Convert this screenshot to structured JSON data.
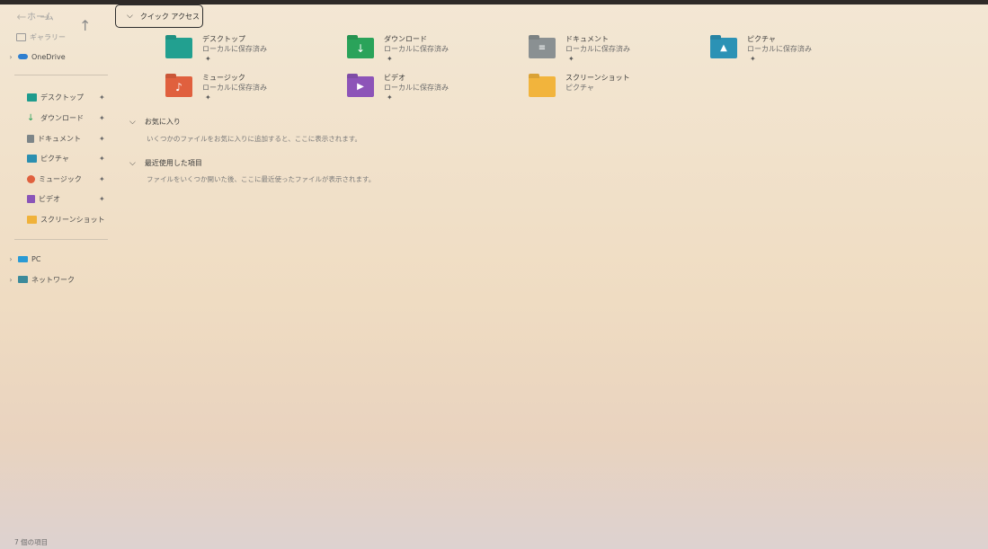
{
  "nav": {
    "home_label": "ホーム"
  },
  "sidebar": {
    "top_items": [
      {
        "label": "ギャラリー",
        "icon": "gallery-icon"
      },
      {
        "label": "OneDrive",
        "icon": "cloud-icon"
      }
    ],
    "pinned": [
      {
        "label": "デスクトップ",
        "icon": "desktop-folder-icon",
        "color": "#1e9c8e"
      },
      {
        "label": "ダウンロード",
        "icon": "download-icon",
        "color": "#2aa35a"
      },
      {
        "label": "ドキュメント",
        "icon": "document-icon",
        "color": "#7d8588"
      },
      {
        "label": "ピクチャ",
        "icon": "pictures-icon",
        "color": "#2b8fb0"
      },
      {
        "label": "ミュージック",
        "icon": "music-icon",
        "color": "#e0603e"
      },
      {
        "label": "ビデオ",
        "icon": "video-icon",
        "color": "#8a55b8"
      },
      {
        "label": "スクリーンショット",
        "icon": "folder-icon",
        "color": "#f0b23a"
      }
    ],
    "bottom_items": [
      {
        "label": "PC",
        "icon": "pc-icon"
      },
      {
        "label": "ネットワーク",
        "icon": "network-icon"
      }
    ]
  },
  "main": {
    "quick_access_title": "クイック アクセス",
    "tiles": [
      {
        "name": "デスクトップ",
        "sub": "ローカルに保存済み",
        "pinned": true,
        "color": "#22a090",
        "icon": "desktop-folder-icon"
      },
      {
        "name": "ダウンロード",
        "sub": "ローカルに保存済み",
        "pinned": true,
        "color": "#2aa35a",
        "icon": "download-folder-icon"
      },
      {
        "name": "ドキュメント",
        "sub": "ローカルに保存済み",
        "pinned": true,
        "color": "#8a9092",
        "icon": "documents-folder-icon"
      },
      {
        "name": "ピクチャ",
        "sub": "ローカルに保存済み",
        "pinned": true,
        "color": "#2b92b5",
        "icon": "pictures-folder-icon"
      },
      {
        "name": "ミュージック",
        "sub": "ローカルに保存済み",
        "pinned": true,
        "color": "#e0603e",
        "icon": "music-folder-icon"
      },
      {
        "name": "ビデオ",
        "sub": "ローカルに保存済み",
        "pinned": true,
        "color": "#8d54b8",
        "icon": "videos-folder-icon"
      },
      {
        "name": "スクリーンショット",
        "sub": "ピクチャ",
        "pinned": false,
        "color": "#f2b43c",
        "icon": "screenshots-folder-icon"
      }
    ],
    "favorites_title": "お気に入り",
    "favorites_desc": "いくつかのファイルをお気に入りに追加すると、ここに表示されます。",
    "recent_title": "最近使用した項目",
    "recent_desc": "ファイルをいくつか開いた後、ここに最近使ったファイルが表示されます。"
  },
  "status": {
    "item_count": "7 個の項目"
  }
}
